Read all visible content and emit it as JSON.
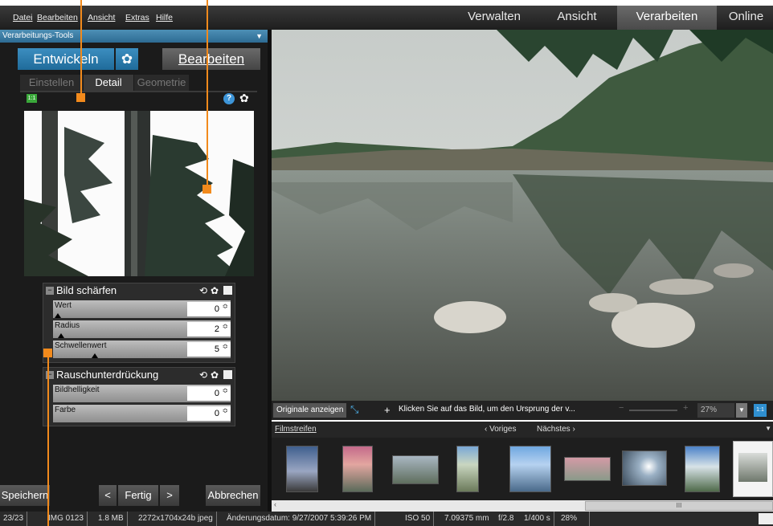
{
  "menu": [
    "Datei",
    "Bearbeiten",
    "Ansicht",
    "Extras",
    "Hilfe"
  ],
  "modes": [
    "Verwalten",
    "Ansicht",
    "Verarbeiten",
    "Online"
  ],
  "panel_title": "Verarbeitungs-Tools",
  "develop_btn": "Entwickeln",
  "edit_btn": "Bearbeiten",
  "subtabs": [
    "Einstellen",
    "Detail",
    "Geometrie"
  ],
  "zoom_badge": "1:1",
  "sharpen": {
    "title": "Bild schärfen",
    "rows": [
      {
        "label": "Wert",
        "value": "0"
      },
      {
        "label": "Radius",
        "value": "2"
      },
      {
        "label": "Schwellenwert",
        "value": "5"
      }
    ]
  },
  "noise": {
    "title": "Rauschunterdrückung",
    "rows": [
      {
        "label": "Bildhelligkeit",
        "value": "0"
      },
      {
        "label": "Farbe",
        "value": "0"
      }
    ]
  },
  "bottom_buttons": {
    "save": "Speichern",
    "prev": "<",
    "done": "Fertig",
    "next": ">",
    "cancel": "Abbrechen"
  },
  "toolbar": {
    "originals": "Originale anzeigen",
    "hint": "Klicken Sie auf das Bild, um den Ursprung der v...",
    "zoom": "27%",
    "one_to_one": "1:1"
  },
  "filmstrip": {
    "title": "Filmstreifen",
    "prev": "Voriges",
    "next": "Nächstes"
  },
  "scroll_label": "III",
  "status": [
    "23/23",
    "IMG 0123",
    "1.8 MB",
    "2272x1704x24b jpeg",
    "Änderungsdatum: 9/27/2007 5:39:26 PM",
    "ISO 50",
    "7.09375 mm",
    "f/2.8",
    "1/400 s",
    "28%"
  ],
  "colors": {
    "accent_blue": "#2f7fb0",
    "callout": "#f28a1c"
  }
}
